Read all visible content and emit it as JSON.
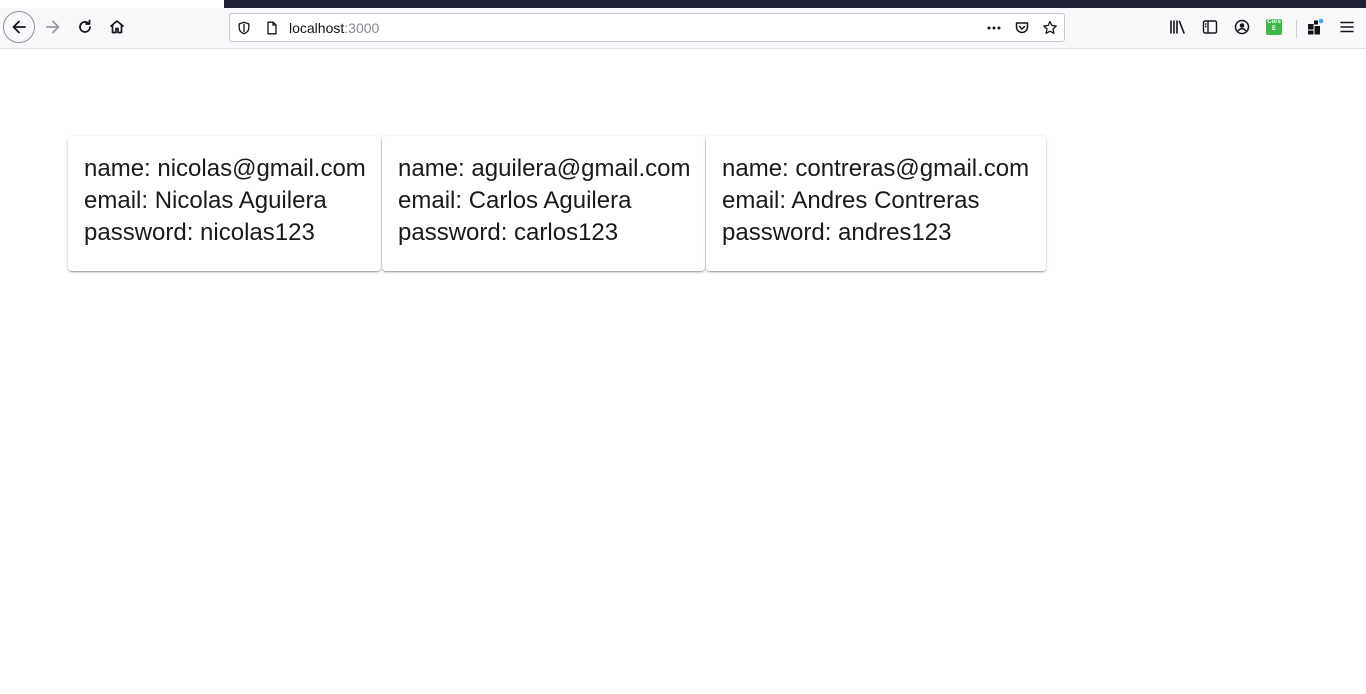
{
  "browser": {
    "url_host": "localhost",
    "url_port": ":3000",
    "extension_badge": [
      "Cors",
      "E"
    ],
    "icons": {
      "back": "back-arrow-icon",
      "forward": "forward-arrow-icon",
      "reload": "reload-icon",
      "home": "home-icon",
      "tracking": "tracking-shield-icon",
      "page": "page-info-icon",
      "more": "more-actions-icon",
      "pocket": "pocket-icon",
      "bookmark": "bookmark-star-icon",
      "library": "library-icon",
      "sidebar": "sidebar-icon",
      "account": "account-icon",
      "extensions": "extensions-icon",
      "menu": "hamburger-menu-icon"
    }
  },
  "users": [
    {
      "name_label": "name: nicolas@gmail.com",
      "email_label": "email: Nicolas Aguilera",
      "password_label": "password: nicolas123"
    },
    {
      "name_label": "name: aguilera@gmail.com",
      "email_label": "email: Carlos Aguilera",
      "password_label": "password: carlos123"
    },
    {
      "name_label": "name: contreras@gmail.com",
      "email_label": "email: Andres Contreras",
      "password_label": "password: andres123"
    }
  ]
}
